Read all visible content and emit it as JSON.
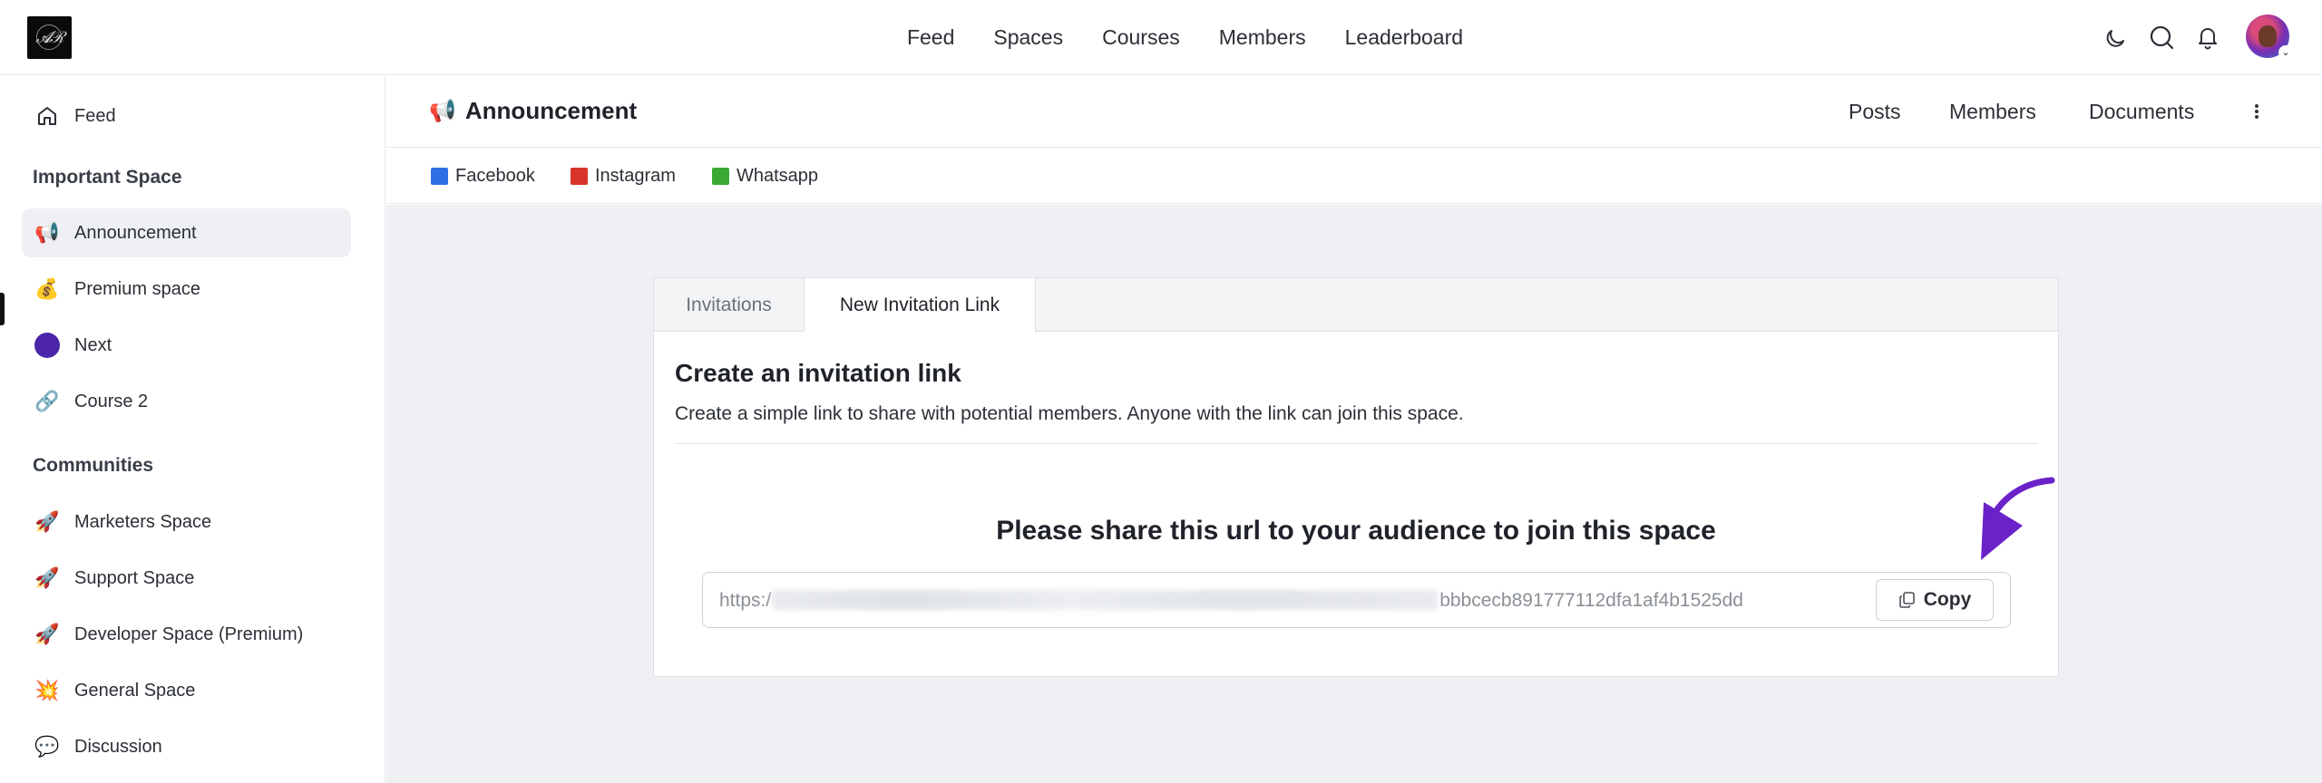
{
  "topnav": {
    "items": [
      "Feed",
      "Spaces",
      "Courses",
      "Members",
      "Leaderboard"
    ]
  },
  "sidebar": {
    "feed": {
      "label": "Feed",
      "icon": "home-icon"
    },
    "important_heading": "Important Space",
    "important_items": [
      {
        "label": "Announcement",
        "icon": "megaphone-icon",
        "active": true
      },
      {
        "label": "Premium space",
        "icon": "money-bag-icon"
      },
      {
        "label": "Next",
        "icon": "purple-circle-icon"
      },
      {
        "label": "Course 2",
        "icon": "link-icon"
      }
    ],
    "communities_heading": "Communities",
    "community_items": [
      {
        "label": "Marketers Space",
        "icon": "rocket-icon"
      },
      {
        "label": "Support Space",
        "icon": "rocket-icon"
      },
      {
        "label": "Developer Space (Premium)",
        "icon": "rocket-icon"
      },
      {
        "label": "General Space",
        "icon": "collision-icon"
      },
      {
        "label": "Discussion",
        "icon": "speech-bubble-icon"
      }
    ]
  },
  "space_header": {
    "title": "Announcement",
    "tabs": [
      "Posts",
      "Members",
      "Documents"
    ]
  },
  "links": [
    {
      "label": "Facebook",
      "color": "#2f6fe4"
    },
    {
      "label": "Instagram",
      "color": "#d9342b"
    },
    {
      "label": "Whatsapp",
      "color": "#3aaa35"
    }
  ],
  "invite_card": {
    "tabs": [
      "Invitations",
      "New Invitation Link"
    ],
    "active_tab": "New Invitation Link",
    "title": "Create an invitation link",
    "description": "Create a simple link to share with potential members. Anyone with the link can join this space.",
    "share_title": "Please share this url to your audience to join this space",
    "url_prefix": "https:/",
    "url_suffix": "bbbcecb891777112dfa1af4b1525dd",
    "copy_label": "Copy"
  },
  "colors": {
    "accent_arrow": "#6a22c9",
    "page_bg": "#eef0f3"
  }
}
